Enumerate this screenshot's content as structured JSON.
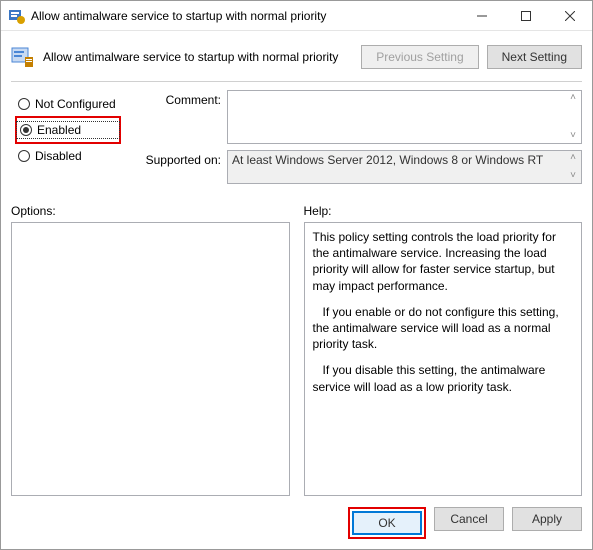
{
  "window": {
    "title": "Allow antimalware service to startup with normal priority"
  },
  "header": {
    "text": "Allow antimalware service to startup with normal priority",
    "prev_btn": "Previous Setting",
    "next_btn": "Next Setting"
  },
  "radios": {
    "not_configured": "Not Configured",
    "enabled": "Enabled",
    "disabled": "Disabled"
  },
  "fields": {
    "comment_label": "Comment:",
    "supported_label": "Supported on:",
    "supported_text": "At least Windows Server 2012, Windows 8 or Windows RT"
  },
  "options": {
    "label": "Options:"
  },
  "help": {
    "label": "Help:",
    "p1": "This policy setting controls the load priority for the antimalware service. Increasing the load priority will allow for faster service startup, but may impact performance.",
    "p2": "If you enable or do not configure this setting, the antimalware service will load as a normal priority task.",
    "p3": "If you disable this setting, the antimalware service will load as a low priority task."
  },
  "footer": {
    "ok": "OK",
    "cancel": "Cancel",
    "apply": "Apply"
  }
}
